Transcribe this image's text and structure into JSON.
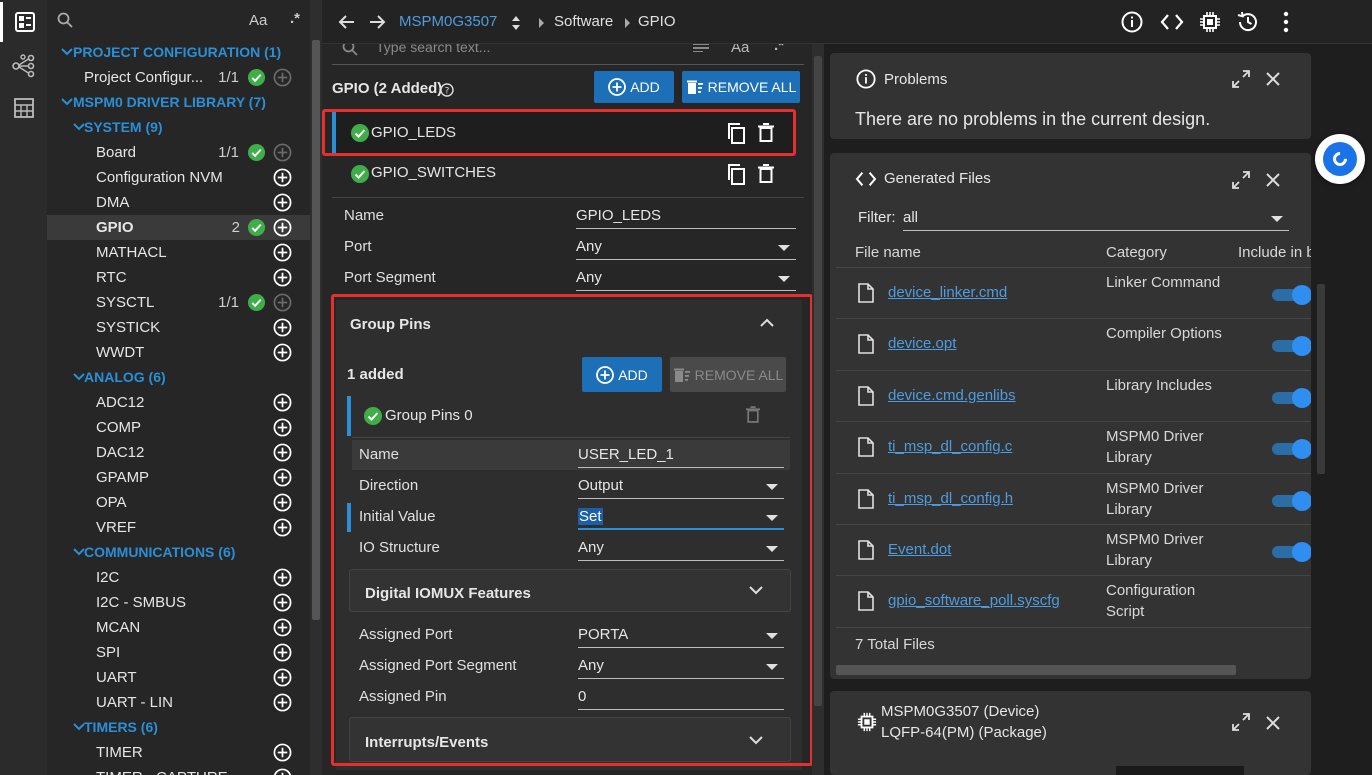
{
  "tree": {
    "items": [
      {
        "type": "cat",
        "level": 0,
        "label": "PROJECT CONFIGURATION (1)"
      },
      {
        "type": "leaf",
        "level": 1,
        "label": "Project Configur...",
        "count": "1/1",
        "status": "ok",
        "add": "disabled"
      },
      {
        "type": "cat",
        "level": 0,
        "label": "MSPM0 DRIVER LIBRARY (7)"
      },
      {
        "type": "cat",
        "level": 1,
        "label": "SYSTEM (9)"
      },
      {
        "type": "leaf",
        "level": 2,
        "label": "Board",
        "count": "1/1",
        "status": "ok",
        "add": "disabled"
      },
      {
        "type": "leaf",
        "level": 2,
        "label": "Configuration NVM",
        "add": "enabled"
      },
      {
        "type": "leaf",
        "level": 2,
        "label": "DMA",
        "add": "enabled"
      },
      {
        "type": "leaf",
        "level": 2,
        "label": "GPIO",
        "count": "2",
        "status": "ok",
        "add": "enabled",
        "selected": true
      },
      {
        "type": "leaf",
        "level": 2,
        "label": "MATHACL",
        "add": "enabled"
      },
      {
        "type": "leaf",
        "level": 2,
        "label": "RTC",
        "add": "enabled"
      },
      {
        "type": "leaf",
        "level": 2,
        "label": "SYSCTL",
        "count": "1/1",
        "status": "ok",
        "add": "disabled"
      },
      {
        "type": "leaf",
        "level": 2,
        "label": "SYSTICK",
        "add": "enabled"
      },
      {
        "type": "leaf",
        "level": 2,
        "label": "WWDT",
        "add": "enabled"
      },
      {
        "type": "cat",
        "level": 1,
        "label": "ANALOG (6)"
      },
      {
        "type": "leaf",
        "level": 2,
        "label": "ADC12",
        "add": "enabled"
      },
      {
        "type": "leaf",
        "level": 2,
        "label": "COMP",
        "add": "enabled"
      },
      {
        "type": "leaf",
        "level": 2,
        "label": "DAC12",
        "add": "enabled"
      },
      {
        "type": "leaf",
        "level": 2,
        "label": "GPAMP",
        "add": "enabled"
      },
      {
        "type": "leaf",
        "level": 2,
        "label": "OPA",
        "add": "enabled"
      },
      {
        "type": "leaf",
        "level": 2,
        "label": "VREF",
        "add": "enabled"
      },
      {
        "type": "cat",
        "level": 1,
        "label": "COMMUNICATIONS (6)"
      },
      {
        "type": "leaf",
        "level": 2,
        "label": "I2C",
        "add": "enabled"
      },
      {
        "type": "leaf",
        "level": 2,
        "label": "I2C - SMBUS",
        "add": "enabled"
      },
      {
        "type": "leaf",
        "level": 2,
        "label": "MCAN",
        "add": "enabled"
      },
      {
        "type": "leaf",
        "level": 2,
        "label": "SPI",
        "add": "enabled"
      },
      {
        "type": "leaf",
        "level": 2,
        "label": "UART",
        "add": "enabled"
      },
      {
        "type": "leaf",
        "level": 2,
        "label": "UART - LIN",
        "add": "enabled"
      },
      {
        "type": "cat",
        "level": 1,
        "label": "TIMERS (6)"
      },
      {
        "type": "leaf",
        "level": 2,
        "label": "TIMER",
        "add": "enabled"
      },
      {
        "type": "leaf",
        "level": 2,
        "label": "TIMER - CAPTURE",
        "add": "enabled"
      }
    ],
    "search_case": "Aa",
    "search_regex": ".*"
  },
  "topbar": {
    "device": "MSPM0G3507",
    "crumb1": "Software",
    "crumb2": "GPIO"
  },
  "mid": {
    "search_placeholder": "Type search text...",
    "search_case": "Aa",
    "title": "GPIO (2 Added)",
    "add_label": "ADD",
    "remove_all_label": "REMOVE ALL",
    "instances": [
      "GPIO_LEDS",
      "GPIO_SWITCHES"
    ],
    "fields": {
      "name_label": "Name",
      "name_value": "GPIO_LEDS",
      "port_label": "Port",
      "port_value": "Any",
      "segment_label": "Port Segment",
      "segment_value": "Any"
    },
    "group": {
      "title": "Group Pins",
      "added": "1 added",
      "add_label": "ADD",
      "remove_all_label": "REMOVE ALL",
      "item": "Group Pins 0",
      "name_label": "Name",
      "name_value": "USER_LED_1",
      "direction_label": "Direction",
      "direction_value": "Output",
      "initial_label": "Initial Value",
      "initial_value": "Set",
      "io_label": "IO Structure",
      "io_value": "Any",
      "digital_title": "Digital IOMUX Features",
      "aport_label": "Assigned Port",
      "aport_value": "PORTA",
      "aseg_label": "Assigned Port Segment",
      "aseg_value": "Any",
      "apin_label": "Assigned Pin",
      "apin_value": "0",
      "interrupts_title": "Interrupts/Events"
    }
  },
  "problems": {
    "title": "Problems",
    "message": "There are no problems in the current design."
  },
  "generated": {
    "title": "Generated Files",
    "filter_label": "Filter:",
    "filter_value": "all",
    "col_file": "File name",
    "col_cat": "Category",
    "col_include": "Include in b",
    "files": [
      {
        "name": "device_linker.cmd",
        "cat": "Linker Command",
        "toggle": true
      },
      {
        "name": "device.opt",
        "cat": "Compiler Options",
        "toggle": true
      },
      {
        "name": "device.cmd.genlibs",
        "cat": "Library Includes",
        "toggle": true
      },
      {
        "name": "ti_msp_dl_config.c",
        "cat": "MSPM0 Driver Library",
        "toggle": true
      },
      {
        "name": "ti_msp_dl_config.h",
        "cat": "MSPM0 Driver Library",
        "toggle": true
      },
      {
        "name": "Event.dot",
        "cat": "MSPM0 Driver Library",
        "toggle": true
      },
      {
        "name": "gpio_software_poll.syscfg",
        "cat": "Configuration Script",
        "toggle": false
      }
    ],
    "total": "7 Total Files"
  },
  "device_panel": {
    "line1": "MSPM0G3507 (Device)",
    "line2": "LQFP-64(PM) (Package)"
  },
  "colors": {
    "accent": "#2a8fd6",
    "primary_button": "#1d6fb8",
    "ok_green": "#3fae49",
    "highlight_red": "#e53030",
    "link": "#4d9ce0"
  }
}
